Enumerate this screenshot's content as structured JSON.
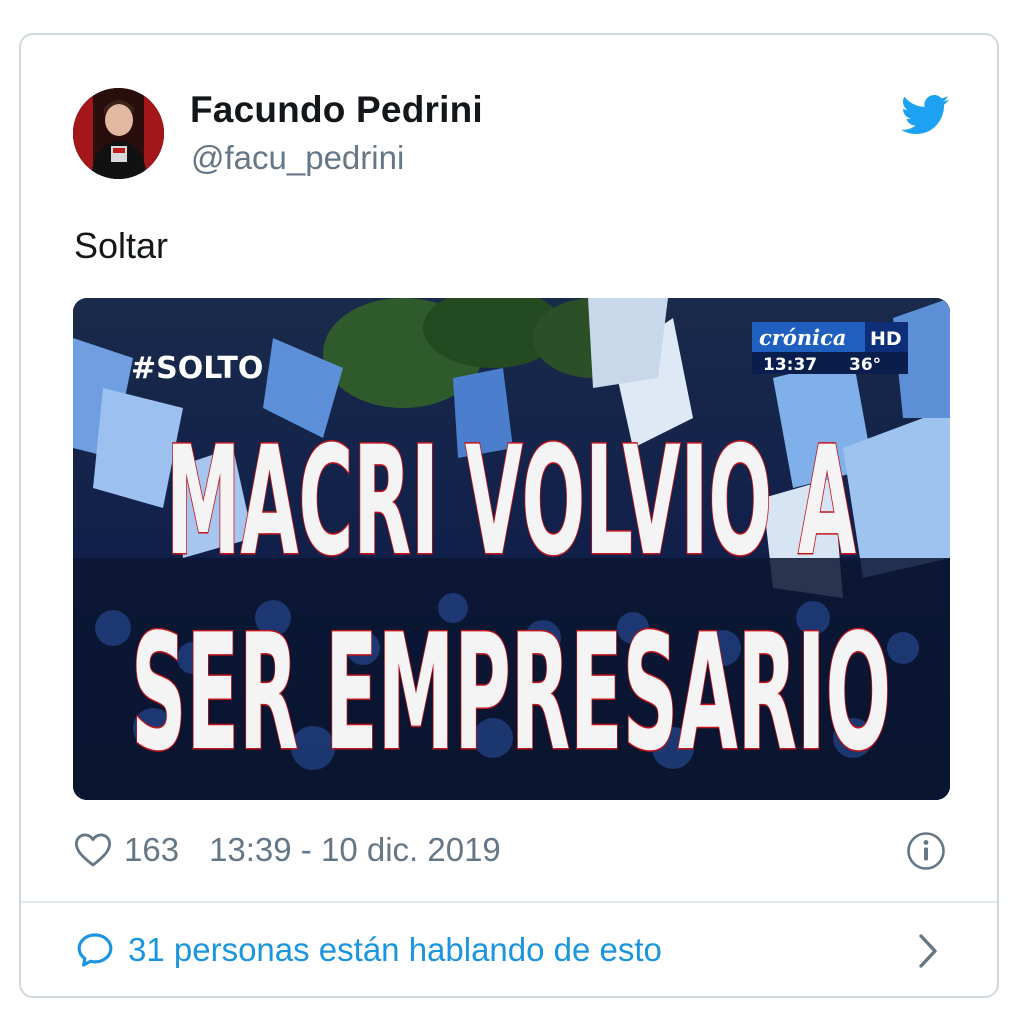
{
  "tweet": {
    "author_name": "Facundo Pedrini",
    "author_handle": "@facu_pedrini",
    "text": "Soltar",
    "likes": "163",
    "timestamp": "13:39 - 10 dic. 2019",
    "conversation": "31 personas están hablando de esto"
  },
  "media": {
    "hashtag": "#SOLTO",
    "channel_logo": "crónica",
    "channel_hd": "HD",
    "clock": "13:37",
    "temperature": "36°",
    "headline_line1": "MACRI VOLVIO A",
    "headline_line2": "SER EMPRESARIO"
  },
  "icons": {
    "brand": "twitter-bird-icon",
    "like": "heart-icon",
    "info": "info-icon",
    "reply": "speech-bubble-icon",
    "next": "chevron-right-icon"
  },
  "colors": {
    "twitter_blue": "#1da1f2",
    "link_blue": "#1b95e0",
    "muted_gray": "#657786",
    "text_dark": "#14171a",
    "border": "#cfd9de"
  }
}
